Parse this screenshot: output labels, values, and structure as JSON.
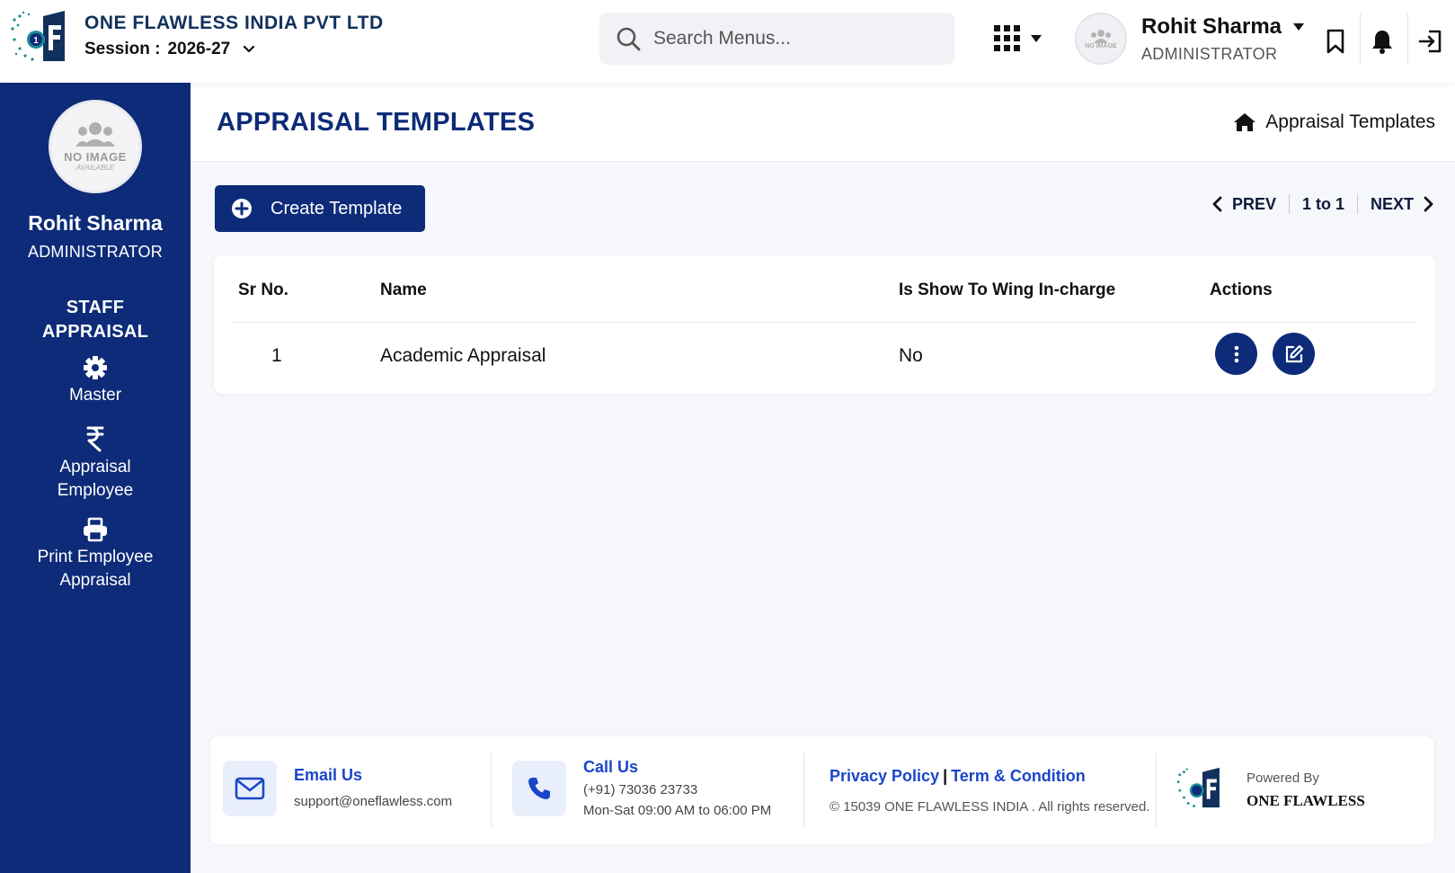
{
  "header": {
    "company_name": "ONE FLAWLESS INDIA PVT LTD",
    "session_label": "Session :",
    "session_value": "2026-27",
    "search_placeholder": "Search Menus...",
    "user_name": "Rohit Sharma",
    "user_role": "ADMINISTRATOR",
    "avatar_text": "NO IMAGE",
    "avatar_subtext": "AVAILABLE"
  },
  "sidebar": {
    "avatar_text": "NO IMAGE",
    "avatar_subtext": "AVAILABLE",
    "user_name": "Rohit Sharma",
    "user_role": "ADMINISTRATOR",
    "section_line1": "STAFF",
    "section_line2": "APPRAISAL",
    "items": [
      {
        "line1": "Master",
        "line2": "",
        "icon": "gear-icon"
      },
      {
        "line1": "Appraisal",
        "line2": "Employee",
        "icon": "rupee-icon"
      },
      {
        "line1": "Print Employee",
        "line2": "Appraisal",
        "icon": "printer-icon"
      }
    ]
  },
  "page": {
    "title": "APPRAISAL TEMPLATES",
    "breadcrumb": "Appraisal Templates",
    "create_button": "Create Template",
    "pager": {
      "prev": "PREV",
      "range": "1 to 1",
      "next": "NEXT"
    }
  },
  "table": {
    "headers": [
      "Sr No.",
      "Name",
      "Is Show To Wing In-charge",
      "Actions"
    ],
    "rows": [
      {
        "sr": "1",
        "name": "Academic Appraisal",
        "show_to_wing": "No"
      }
    ]
  },
  "footer": {
    "email_title": "Email Us",
    "email_value": "support@oneflawless.com",
    "call_title": "Call Us",
    "call_phone": "(+91) 73036 23733",
    "call_hours": "Mon-Sat 09:00 AM to 06:00 PM",
    "privacy": "Privacy Policy",
    "separator": "|",
    "terms": "Term & Condition",
    "copyright": "© 15039 ONE FLAWLESS INDIA . All rights reserved.",
    "powered_by": "Powered By",
    "powered_name": "ONE FLAWLESS"
  },
  "colors": {
    "primary": "#0d2b78",
    "link": "#1a46c9",
    "background": "#f6f7fb",
    "accent_teal": "#1c8c96"
  }
}
